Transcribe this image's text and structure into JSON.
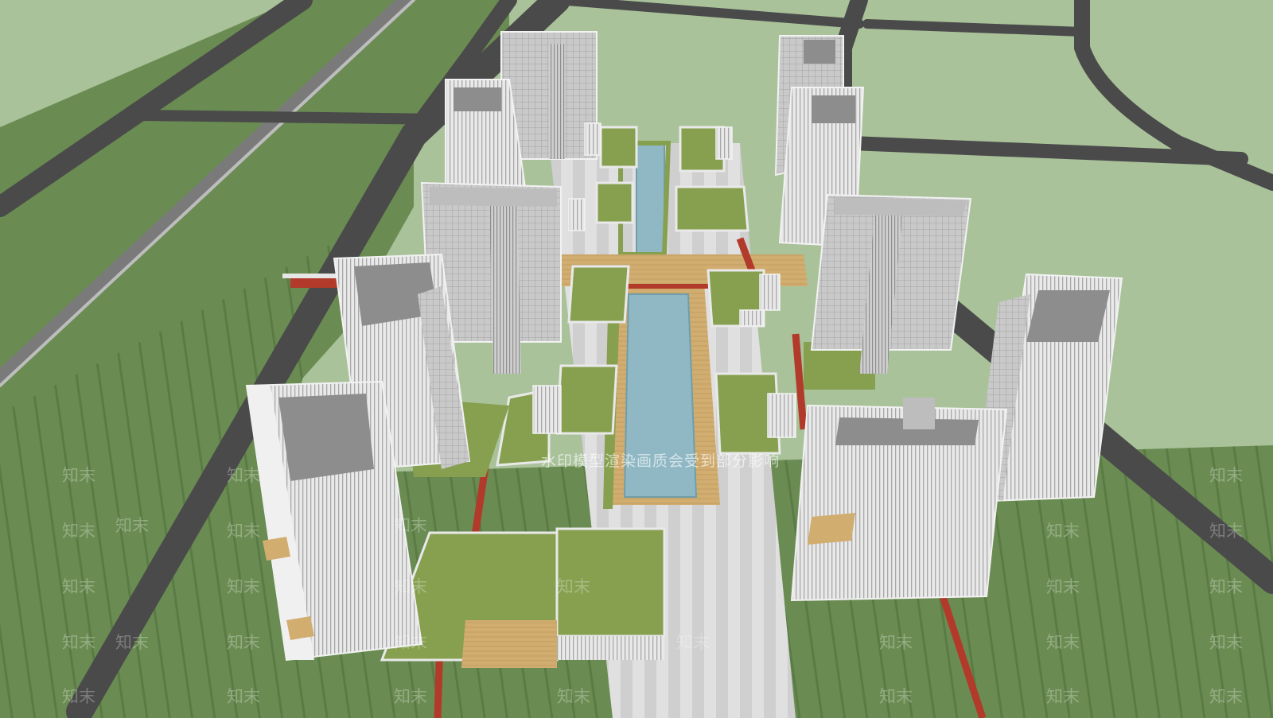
{
  "watermark": {
    "banner_text": "水印模型渲染画质会受到部分影响",
    "tile_text": "知末"
  },
  "colors": {
    "lawn_light": "#a9c29a",
    "lawn_dark": "#6a8c52",
    "road": "#4a4a4a",
    "roof_green": "#86a050",
    "pool": "#8fb8c4",
    "deck": "#d2ad70",
    "walkway_red": "#b23a2a",
    "facade": "#e8e8e8",
    "roof_gray": "#8d8d8d",
    "paving": "#dcdcdc"
  }
}
